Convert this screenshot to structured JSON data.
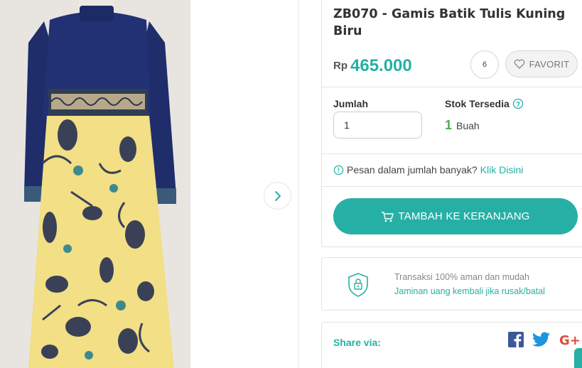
{
  "product": {
    "title": "ZB070 - Gamis Batik Tulis Kuning Biru",
    "currency": "Rp",
    "price": "465.000"
  },
  "favorite": {
    "count": "6",
    "label": "FAVORIT"
  },
  "quantity": {
    "label": "Jumlah",
    "value": "1"
  },
  "stock": {
    "label": "Stok Tersedia",
    "count": "1",
    "unit": "Buah"
  },
  "bulk_order": {
    "text": "Pesan dalam jumlah banyak?",
    "link": "Klik Disini"
  },
  "cart": {
    "label": "TAMBAH KE KERANJANG"
  },
  "trust": {
    "text": "Transaksi 100% aman dan mudah",
    "link": "Jaminan uang kembali jika rusak/batal"
  },
  "share": {
    "label": "Share via:",
    "plus_label": "G+"
  },
  "colors": {
    "accent": "#26b0a5",
    "stock_green": "#4caf50",
    "facebook": "#3b5998",
    "twitter": "#1da1f2",
    "google_plus": "#dd4b39"
  },
  "icons": [
    "chevron-right-icon",
    "heart-icon",
    "question-icon",
    "info-icon",
    "cart-icon",
    "shield-lock-icon",
    "facebook-icon",
    "twitter-icon",
    "google-plus-icon"
  ]
}
